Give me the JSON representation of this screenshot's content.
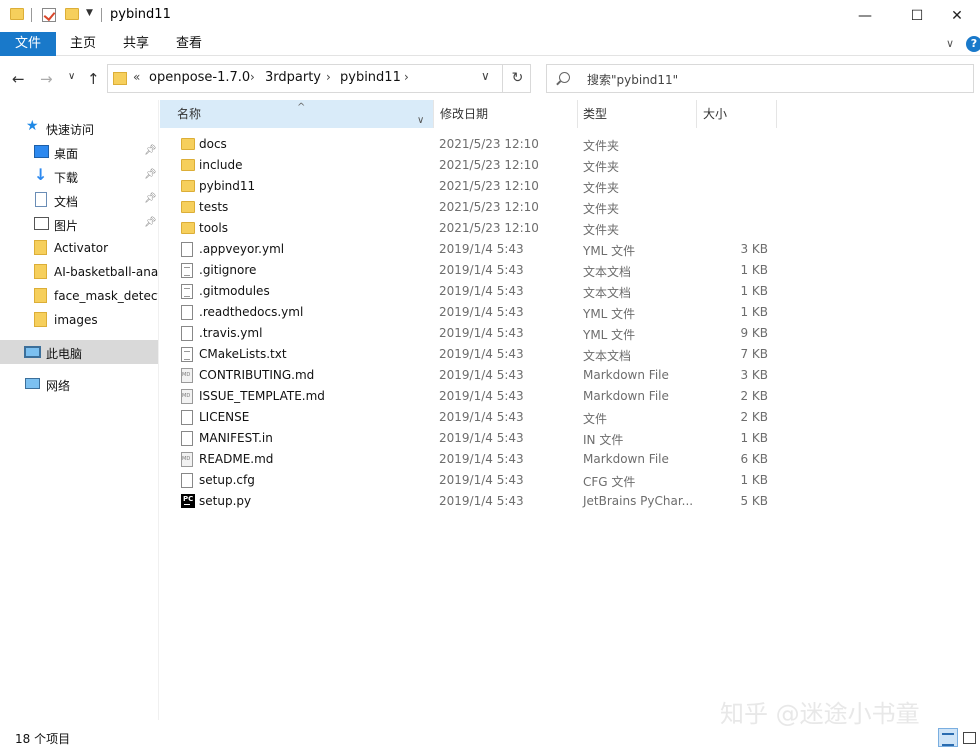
{
  "titlebar": {
    "title": "pybind11",
    "minimize_glyph": "—",
    "maximize_glyph": "☐",
    "close_glyph": "✕"
  },
  "ribbon": {
    "tabs": [
      {
        "label": "文件"
      },
      {
        "label": "主页"
      },
      {
        "label": "共享"
      },
      {
        "label": "查看"
      }
    ],
    "help_glyph": "?"
  },
  "address": {
    "overflow": "«",
    "crumbs": [
      "openpose-1.7.0",
      "3rdparty",
      "pybind11"
    ],
    "separator": "›"
  },
  "search": {
    "placeholder": "搜索\"pybind11\""
  },
  "nav": {
    "quick_access": "快速访问",
    "items": [
      {
        "label": "桌面",
        "icon": "desktop-icon",
        "pinned": true
      },
      {
        "label": "下载",
        "icon": "download-icon",
        "pinned": true
      },
      {
        "label": "文档",
        "icon": "documents-icon",
        "pinned": true
      },
      {
        "label": "图片",
        "icon": "pictures-icon",
        "pinned": true
      },
      {
        "label": "Activator",
        "icon": "folder-icon",
        "pinned": false
      },
      {
        "label": "AI-basketball-ana",
        "icon": "folder-icon",
        "pinned": false
      },
      {
        "label": "face_mask_detecti",
        "icon": "folder-icon",
        "pinned": false
      },
      {
        "label": "images",
        "icon": "folder-icon",
        "pinned": false
      }
    ],
    "this_pc": "此电脑",
    "network": "网络"
  },
  "columns": {
    "name": "名称",
    "date": "修改日期",
    "type": "类型",
    "size": "大小"
  },
  "files": [
    {
      "name": "docs",
      "date": "2021/5/23 12:10",
      "type": "文件夹",
      "size": "",
      "icon": "folder"
    },
    {
      "name": "include",
      "date": "2021/5/23 12:10",
      "type": "文件夹",
      "size": "",
      "icon": "folder"
    },
    {
      "name": "pybind11",
      "date": "2021/5/23 12:10",
      "type": "文件夹",
      "size": "",
      "icon": "folder"
    },
    {
      "name": "tests",
      "date": "2021/5/23 12:10",
      "type": "文件夹",
      "size": "",
      "icon": "folder"
    },
    {
      "name": "tools",
      "date": "2021/5/23 12:10",
      "type": "文件夹",
      "size": "",
      "icon": "folder"
    },
    {
      "name": ".appveyor.yml",
      "date": "2019/1/4 5:43",
      "type": "YML 文件",
      "size": "3 KB",
      "icon": "file"
    },
    {
      "name": ".gitignore",
      "date": "2019/1/4 5:43",
      "type": "文本文档",
      "size": "1 KB",
      "icon": "textfile"
    },
    {
      "name": ".gitmodules",
      "date": "2019/1/4 5:43",
      "type": "文本文档",
      "size": "1 KB",
      "icon": "textfile"
    },
    {
      "name": ".readthedocs.yml",
      "date": "2019/1/4 5:43",
      "type": "YML 文件",
      "size": "1 KB",
      "icon": "file"
    },
    {
      "name": ".travis.yml",
      "date": "2019/1/4 5:43",
      "type": "YML 文件",
      "size": "9 KB",
      "icon": "file"
    },
    {
      "name": "CMakeLists.txt",
      "date": "2019/1/4 5:43",
      "type": "文本文档",
      "size": "7 KB",
      "icon": "textfile"
    },
    {
      "name": "CONTRIBUTING.md",
      "date": "2019/1/4 5:43",
      "type": "Markdown File",
      "size": "3 KB",
      "icon": "md"
    },
    {
      "name": "ISSUE_TEMPLATE.md",
      "date": "2019/1/4 5:43",
      "type": "Markdown File",
      "size": "2 KB",
      "icon": "md"
    },
    {
      "name": "LICENSE",
      "date": "2019/1/4 5:43",
      "type": "文件",
      "size": "2 KB",
      "icon": "file"
    },
    {
      "name": "MANIFEST.in",
      "date": "2019/1/4 5:43",
      "type": "IN 文件",
      "size": "1 KB",
      "icon": "file"
    },
    {
      "name": "README.md",
      "date": "2019/1/4 5:43",
      "type": "Markdown File",
      "size": "6 KB",
      "icon": "md"
    },
    {
      "name": "setup.cfg",
      "date": "2019/1/4 5:43",
      "type": "CFG 文件",
      "size": "1 KB",
      "icon": "file"
    },
    {
      "name": "setup.py",
      "date": "2019/1/4 5:43",
      "type": "JetBrains PyChar...",
      "size": "5 KB",
      "icon": "py"
    }
  ],
  "status": {
    "count": "18 个项目"
  },
  "watermark": "知乎 @迷途小书童",
  "colors": {
    "accent": "#1979ca",
    "selected_header": "#d9ebf9",
    "folder": "#f6cf5c"
  }
}
